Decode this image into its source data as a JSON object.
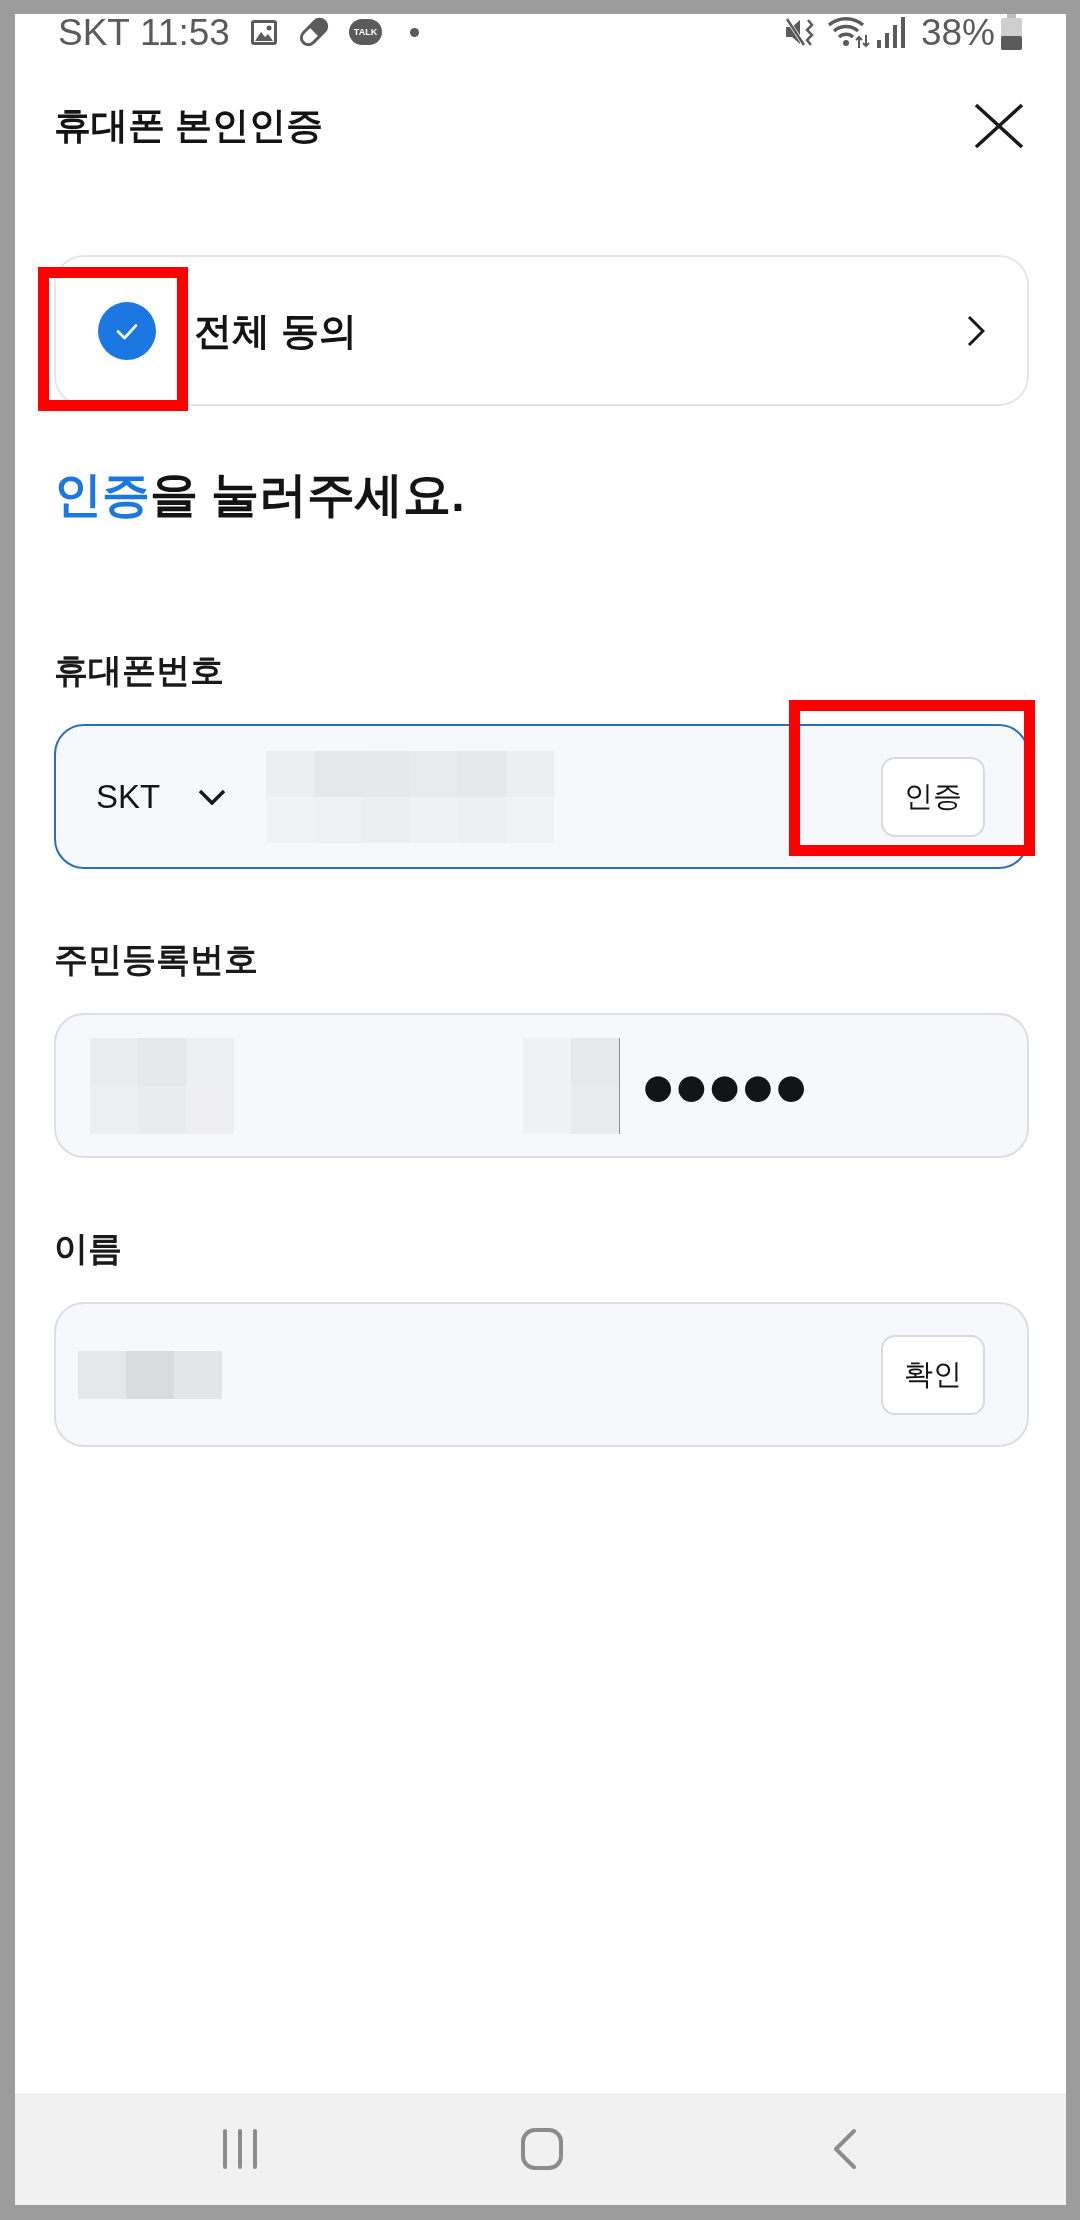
{
  "status_bar": {
    "carrier": "SKT",
    "time": "11:53",
    "app_badge": "TALK",
    "battery": "38%"
  },
  "header": {
    "title": "휴대폰 본인인증"
  },
  "agreement": {
    "label": "전체 동의",
    "checked": true,
    "highlighted": true
  },
  "prompt": {
    "highlight": "인증",
    "text": "을 눌러주세요."
  },
  "fields": [
    {
      "kind": "phone",
      "label": "휴대폰번호",
      "focused": true,
      "carrier": "SKT",
      "button": "인증",
      "button_highlighted": true
    },
    {
      "kind": "resident_number",
      "label": "주민등록번호",
      "focused": false,
      "masked": "●●●●●"
    },
    {
      "kind": "name",
      "label": "이름",
      "focused": false,
      "button": "확인"
    }
  ]
}
